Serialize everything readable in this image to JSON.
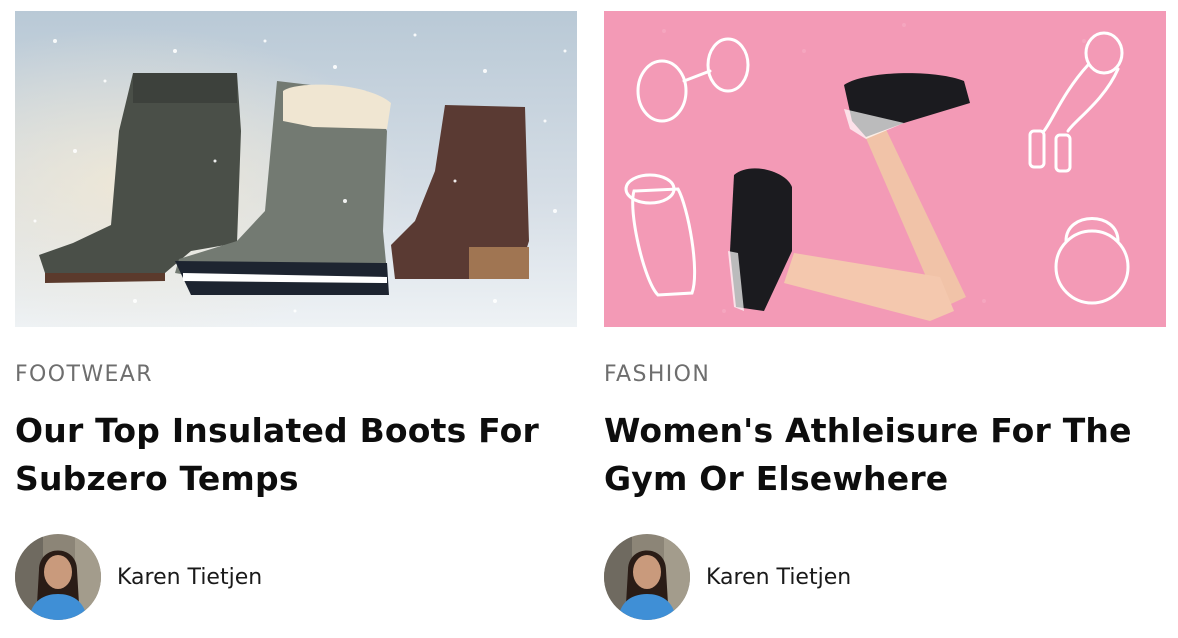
{
  "cards": [
    {
      "category": "FOOTWEAR",
      "title": "Our Top Insulated Boots For Subzero Temps",
      "author": "Karen Tietjen"
    },
    {
      "category": "FASHION",
      "title": "Women's Athleisure For The Gym Or Elsewhere",
      "author": "Karen Tietjen"
    }
  ],
  "colors": {
    "category_gray": "#6e6e6e",
    "title_black": "#0d0d0d",
    "winter_bg": "#cfd9e2",
    "pink_bg": "#f39ab6"
  },
  "images": {
    "card1": "winter-boots-photo",
    "card2": "athleisure-sneakers-photo",
    "avatar": "author-avatar-photo"
  }
}
